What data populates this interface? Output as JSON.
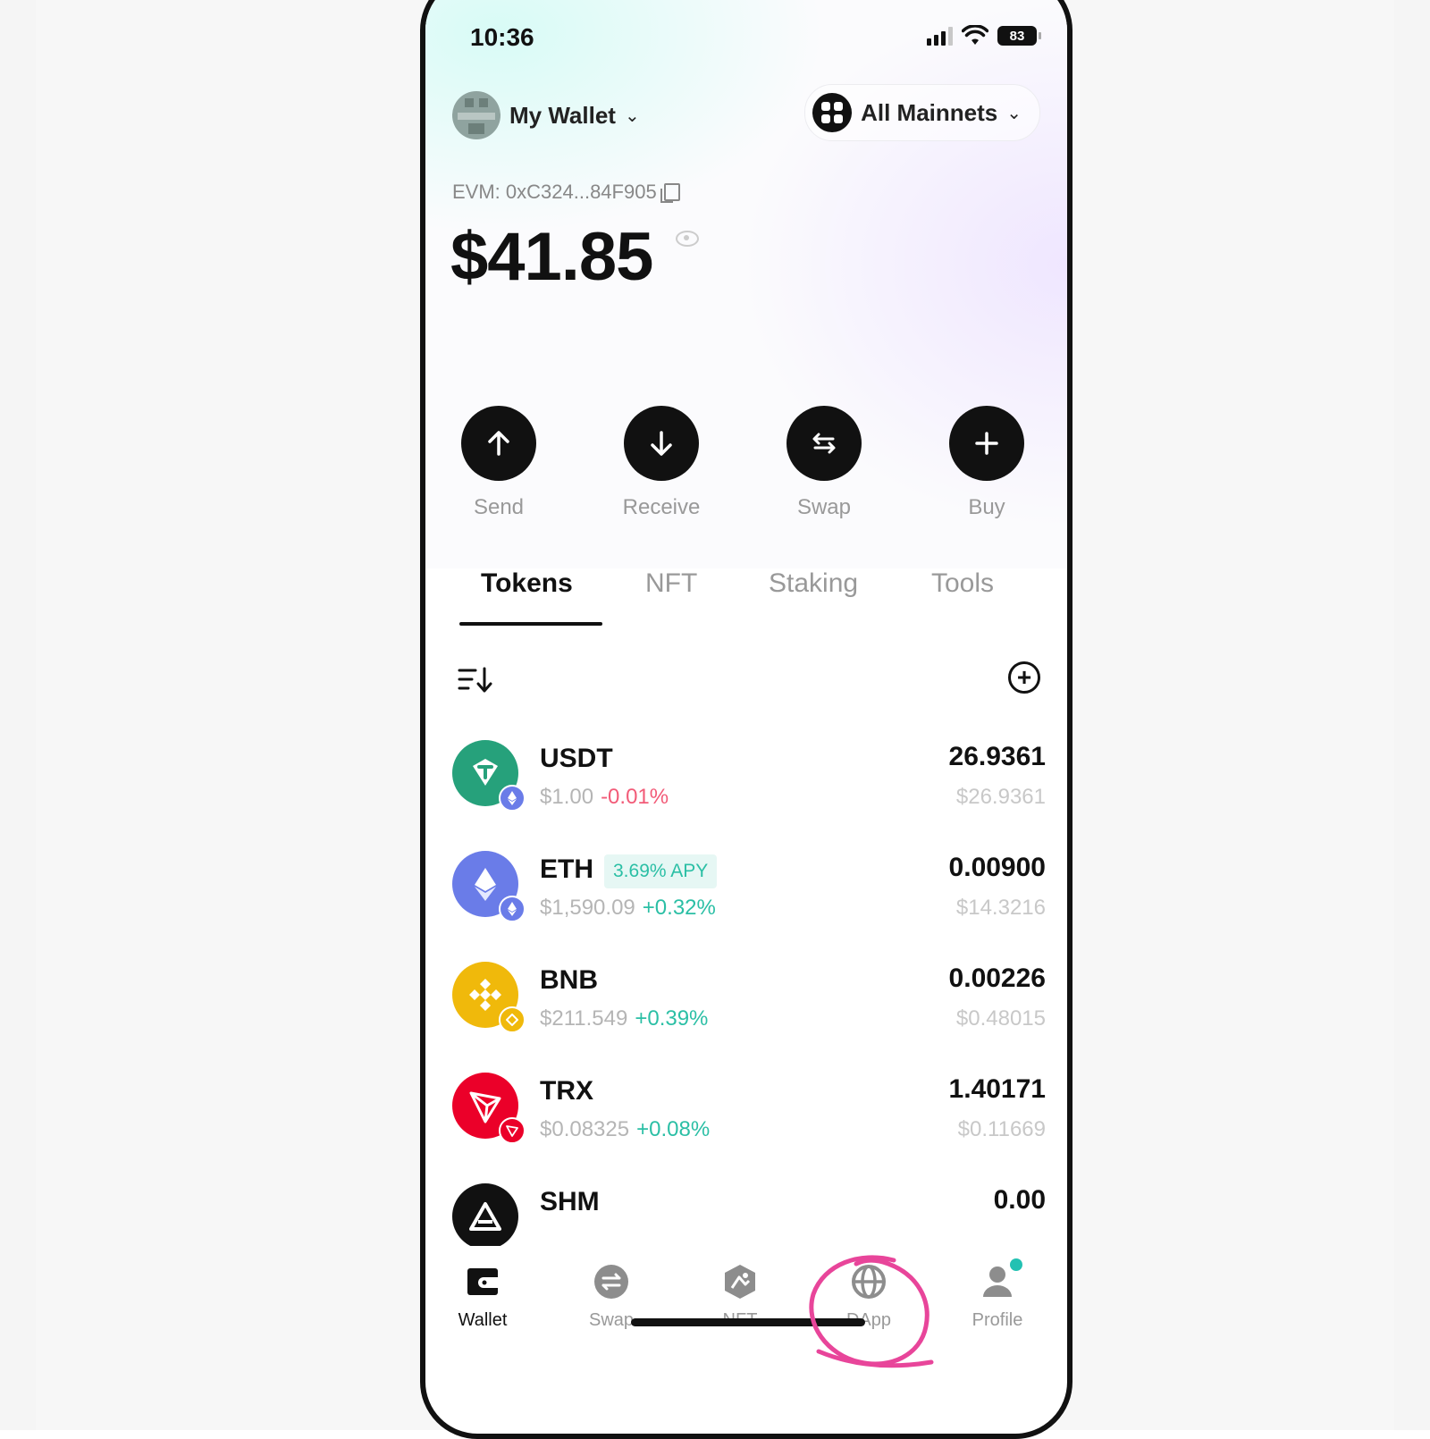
{
  "status_bar": {
    "time": "10:36",
    "battery": "83"
  },
  "header": {
    "wallet_name": "My Wallet",
    "network": "All Mainnets",
    "address": "EVM: 0xC324...84F905",
    "balance": "$41.85"
  },
  "actions": [
    {
      "label": "Send",
      "icon": "arrow-up-icon"
    },
    {
      "label": "Receive",
      "icon": "arrow-down-icon"
    },
    {
      "label": "Swap",
      "icon": "swap-arrows-icon"
    },
    {
      "label": "Buy",
      "icon": "plus-icon"
    }
  ],
  "tabs": [
    {
      "label": "Tokens",
      "active": true
    },
    {
      "label": "NFT",
      "active": false
    },
    {
      "label": "Staking",
      "active": false
    },
    {
      "label": "Tools",
      "active": false
    }
  ],
  "tokens": [
    {
      "symbol": "USDT",
      "price": "$1.00",
      "change": "-0.01%",
      "direction": "neg",
      "amount": "26.9361",
      "value": "$26.9361",
      "color": "#26A17B",
      "badge_color": "#6a7ce8"
    },
    {
      "symbol": "ETH",
      "apy": "3.69% APY",
      "price": "$1,590.09",
      "change": "+0.32%",
      "direction": "pos",
      "amount": "0.00900",
      "value": "$14.3216",
      "color": "#6a7ce8",
      "badge_color": "#6a7ce8"
    },
    {
      "symbol": "BNB",
      "price": "$211.549",
      "change": "+0.39%",
      "direction": "pos",
      "amount": "0.00226",
      "value": "$0.48015",
      "color": "#F0B90B",
      "badge_color": "#F0B90B"
    },
    {
      "symbol": "TRX",
      "price": "$0.08325",
      "change": "+0.08%",
      "direction": "pos",
      "amount": "1.40171",
      "value": "$0.11669",
      "color": "#EB0029",
      "badge_color": "#EB0029"
    },
    {
      "symbol": "SHM",
      "amount": "0.00",
      "color": "#111111"
    }
  ],
  "bottom_nav": [
    {
      "label": "Wallet",
      "icon": "wallet-icon",
      "active": true
    },
    {
      "label": "Swap",
      "icon": "swap-icon",
      "active": false
    },
    {
      "label": "NFT",
      "icon": "nft-icon",
      "active": false
    },
    {
      "label": "DApp",
      "icon": "globe-icon",
      "active": false
    },
    {
      "label": "Profile",
      "icon": "profile-icon",
      "active": false
    }
  ],
  "colors": {
    "positive": "#2bbfa5",
    "negative": "#f25b78",
    "annotation": "#e8459a"
  }
}
